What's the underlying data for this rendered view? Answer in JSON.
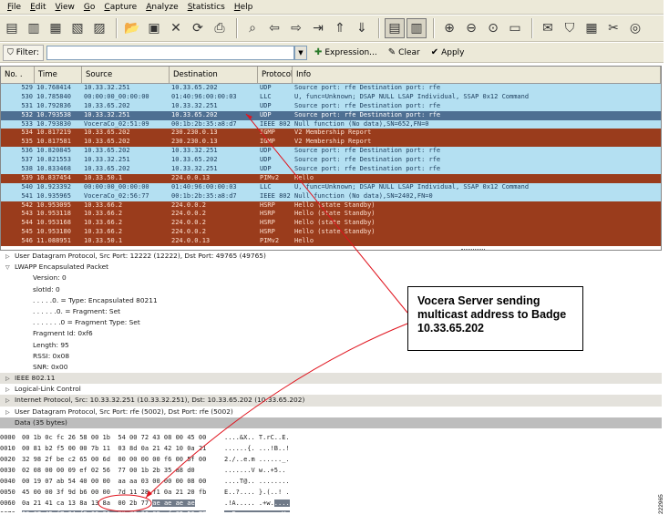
{
  "menubar": {
    "items": [
      "File",
      "Edit",
      "View",
      "Go",
      "Capture",
      "Analyze",
      "Statistics",
      "Help"
    ]
  },
  "toolbar": {
    "buttons": [
      {
        "name": "interface-list-icon",
        "glyph": "▤"
      },
      {
        "name": "capture-options-icon",
        "glyph": "▥"
      },
      {
        "name": "start-capture-icon",
        "glyph": "▦"
      },
      {
        "name": "stop-capture-icon",
        "glyph": "▧"
      },
      {
        "name": "restart-capture-icon",
        "glyph": "▨"
      },
      {
        "name": "open-file-icon",
        "glyph": "📂"
      },
      {
        "name": "save-file-icon",
        "glyph": "▣"
      },
      {
        "name": "close-file-icon",
        "glyph": "✕"
      },
      {
        "name": "reload-icon",
        "glyph": "⟳"
      },
      {
        "name": "print-icon",
        "glyph": "⎙"
      },
      {
        "name": "find-packet-icon",
        "glyph": "⌕"
      },
      {
        "name": "go-back-icon",
        "glyph": "⇦"
      },
      {
        "name": "go-forward-icon",
        "glyph": "⇨"
      },
      {
        "name": "go-to-packet-icon",
        "glyph": "⇥"
      },
      {
        "name": "go-first-icon",
        "glyph": "⇑"
      },
      {
        "name": "go-last-icon",
        "glyph": "⇓"
      },
      {
        "name": "colorize-icon",
        "glyph": "▤"
      },
      {
        "name": "auto-scroll-icon",
        "glyph": "▥"
      },
      {
        "name": "zoom-in-icon",
        "glyph": "⊕"
      },
      {
        "name": "zoom-out-icon",
        "glyph": "⊖"
      },
      {
        "name": "zoom-normal-icon",
        "glyph": "⊙"
      },
      {
        "name": "resize-columns-icon",
        "glyph": "▭"
      },
      {
        "name": "capture-filters-icon",
        "glyph": "✉"
      },
      {
        "name": "display-filters-icon",
        "glyph": "⛉"
      },
      {
        "name": "coloring-rules-icon",
        "glyph": "▦"
      },
      {
        "name": "preferences-icon",
        "glyph": "✂"
      },
      {
        "name": "help-icon",
        "glyph": "◎"
      }
    ]
  },
  "filter": {
    "label": "Filter:",
    "value": "",
    "expression_label": "Expression...",
    "clear_label": "Clear",
    "apply_label": "Apply"
  },
  "packet_list": {
    "columns": [
      "No. .",
      "Time",
      "Source",
      "Destination",
      "Protocol",
      "Info"
    ],
    "rows": [
      {
        "no": "529",
        "time": "10.768414",
        "src": "10.33.32.251",
        "dst": "10.33.65.202",
        "proto": "UDP",
        "info": "Source port: rfe  Destination port: rfe",
        "style": "udp"
      },
      {
        "no": "530",
        "time": "10.785840",
        "src": "00:00:00_00:00:00",
        "dst": "01:40:96:00:00:03",
        "proto": "LLC",
        "info": "U, func=Unknown; DSAP NULL LSAP Individual, SSAP 0x12 Command",
        "style": "udp"
      },
      {
        "no": "531",
        "time": "10.792836",
        "src": "10.33.65.202",
        "dst": "10.33.32.251",
        "proto": "UDP",
        "info": "Source port: rfe  Destination port: rfe",
        "style": "udp"
      },
      {
        "no": "532",
        "time": "10.793538",
        "src": "10.33.32.251",
        "dst": "10.33.65.202",
        "proto": "UDP",
        "info": "Source port: rfe  Destination port: rfe",
        "style": "sel"
      },
      {
        "no": "533",
        "time": "10.793830",
        "src": "VoceraCo_02:51:09",
        "dst": "00:1b:2b:35:a8:d7",
        "proto": "IEEE 802",
        "info": "Null function (No data),SN=652,FN=0",
        "style": "udp"
      },
      {
        "no": "534",
        "time": "10.817219",
        "src": "10.33.65.202",
        "dst": "230.230.0.13",
        "proto": "IGMP",
        "info": "V2 Membership Report",
        "style": "mc"
      },
      {
        "no": "535",
        "time": "10.817581",
        "src": "10.33.65.202",
        "dst": "230.230.0.13",
        "proto": "IGMP",
        "info": "V2 Membership Report",
        "style": "mc"
      },
      {
        "no": "536",
        "time": "10.820845",
        "src": "10.33.65.202",
        "dst": "10.33.32.251",
        "proto": "UDP",
        "info": "Source port: rfe  Destination port: rfe",
        "style": "udp"
      },
      {
        "no": "537",
        "time": "10.821553",
        "src": "10.33.32.251",
        "dst": "10.33.65.202",
        "proto": "UDP",
        "info": "Source port: rfe  Destination port: rfe",
        "style": "udp"
      },
      {
        "no": "538",
        "time": "10.833468",
        "src": "10.33.65.202",
        "dst": "10.33.32.251",
        "proto": "UDP",
        "info": "Source port: rfe  Destination port: rfe",
        "style": "udp"
      },
      {
        "no": "539",
        "time": "10.837454",
        "src": "10.33.50.1",
        "dst": "224.0.0.13",
        "proto": "PIMv2",
        "info": "Hello",
        "style": "mc"
      },
      {
        "no": "540",
        "time": "10.923392",
        "src": "00:00:00_00:00:00",
        "dst": "01:40:96:00:00:03",
        "proto": "LLC",
        "info": "U, func=Unknown; DSAP NULL LSAP Individual, SSAP 0x12 Command",
        "style": "udp"
      },
      {
        "no": "541",
        "time": "10.935965",
        "src": "VoceraCo_02:56:77",
        "dst": "00:1b:2b:35:a8:d7",
        "proto": "IEEE 802",
        "info": "Null function (No data),SN=2402,FN=0",
        "style": "udp"
      },
      {
        "no": "542",
        "time": "10.953095",
        "src": "10.33.66.2",
        "dst": "224.0.0.2",
        "proto": "HSRP",
        "info": "Hello (state Standby)",
        "style": "mc"
      },
      {
        "no": "543",
        "time": "10.953118",
        "src": "10.33.66.2",
        "dst": "224.0.0.2",
        "proto": "HSRP",
        "info": "Hello (state Standby)",
        "style": "mc"
      },
      {
        "no": "544",
        "time": "10.953168",
        "src": "10.33.66.2",
        "dst": "224.0.0.2",
        "proto": "HSRP",
        "info": "Hello (state Standby)",
        "style": "mc"
      },
      {
        "no": "545",
        "time": "10.953180",
        "src": "10.33.66.2",
        "dst": "224.0.0.2",
        "proto": "HSRP",
        "info": "Hello (state Standby)",
        "style": "mc"
      },
      {
        "no": "546",
        "time": "11.088951",
        "src": "10.33.50.1",
        "dst": "224.0.0.13",
        "proto": "PIMv2",
        "info": "Hello",
        "style": "mc"
      }
    ]
  },
  "packet_detail": {
    "lines": [
      {
        "arrow": "▷",
        "indent": 0,
        "text": "User Datagram Protocol, Src Port: 12222 (12222), Dst Port: 49765 (49765)",
        "style": ""
      },
      {
        "arrow": "▽",
        "indent": 0,
        "text": "LWAPP Encapsulated Packet",
        "style": ""
      },
      {
        "arrow": "",
        "indent": 1,
        "text": "Version: 0",
        "style": ""
      },
      {
        "arrow": "",
        "indent": 1,
        "text": "slotId: 0",
        "style": ""
      },
      {
        "arrow": "",
        "indent": 1,
        "text": ". . . . .0. = Type: Encapsulated 80211",
        "style": ""
      },
      {
        "arrow": "",
        "indent": 1,
        "text": ". . . . . .0. = Fragment: Set",
        "style": ""
      },
      {
        "arrow": "",
        "indent": 1,
        "text": ". . . . . . .0 = Fragment Type: Set",
        "style": ""
      },
      {
        "arrow": "",
        "indent": 1,
        "text": "Fragment Id: 0xf6",
        "style": ""
      },
      {
        "arrow": "",
        "indent": 1,
        "text": "Length: 95",
        "style": ""
      },
      {
        "arrow": "",
        "indent": 1,
        "text": "RSSI: 0x08",
        "style": ""
      },
      {
        "arrow": "",
        "indent": 1,
        "text": "SNR: 0x00",
        "style": ""
      },
      {
        "arrow": "▷",
        "indent": 0,
        "text": "IEEE 802.11",
        "style": "grey"
      },
      {
        "arrow": "▷",
        "indent": 0,
        "text": "Logical-Link Control",
        "style": ""
      },
      {
        "arrow": "▷",
        "indent": 0,
        "text": "Internet Protocol, Src: 10.33.32.251 (10.33.32.251), Dst: 10.33.65.202 (10.33.65.202)",
        "style": "grey"
      },
      {
        "arrow": "▷",
        "indent": 0,
        "text": "User Datagram Protocol, Src Port: rfe (5002), Dst Port: rfe (5002)",
        "style": ""
      },
      {
        "arrow": "",
        "indent": 0,
        "text": "Data (35 bytes)",
        "style": "hl"
      }
    ]
  },
  "hex_dump": {
    "rows": [
      {
        "off": "0000",
        "pre": "00 1b 0c fc 26 58 00 1b  54 00 72 43 08 00 45 00",
        "hl": "",
        "post": "",
        "apre": "....&X.. T.rC..E.",
        "ahl": "",
        "apost": ""
      },
      {
        "off": "0010",
        "pre": "00 81 b2 f5 00 00 7b 11  03 8d 0a 21 42 10 0a 21",
        "hl": "",
        "post": "",
        "apre": "......{. ...!B..!",
        "ahl": "",
        "apost": ""
      },
      {
        "off": "0020",
        "pre": "32 98 2f be c2 65 00 6d  00 00 00 00 f6 00 5f 00",
        "hl": "",
        "post": "",
        "apre": "2./..e.m ......_.",
        "ahl": "",
        "apost": ""
      },
      {
        "off": "0030",
        "pre": "02 08 00 00 09 ef 02 56  77 00 1b 2b 35 a8 d0",
        "hl": "",
        "post": "",
        "apre": ".......V w..+5..",
        "ahl": "",
        "apost": ""
      },
      {
        "off": "0040",
        "pre": "00 19 07 ab 54 40 00 00  aa aa 03 00 00 00 08 00",
        "hl": "",
        "post": "",
        "apre": "....T@.. ........",
        "ahl": "",
        "apost": ""
      },
      {
        "off": "0050",
        "pre": "45 00 00 3f 9d b6 00 00  7d 11 28 f1 0a 21 20 fb",
        "hl": "",
        "post": "",
        "apre": "E..?.... }.(..! .",
        "ahl": "",
        "apost": ""
      },
      {
        "off": "0060",
        "pre": "0a 21 41 ca 13 8a 13 8a  00 2b 77 ",
        "hl": "ae ae ae ae",
        "post": "",
        "apre": ".!A..... .+w.",
        "ahl": "....",
        "apost": ""
      },
      {
        "off": "0070",
        "pre": "",
        "hl": "00 07 45 f7 04 f9 00 00  00 72 00 09 ef 02 56 77",
        "post": "",
        "apre": "",
        "ahl": "..E..... .r....Vw",
        "apost": ""
      },
      {
        "off": "0080",
        "pre": "",
        "hl": "00 03 00 01 00 ",
        "post": "",
        "hl2": "e6 e6 00 0d",
        "post2": " 11 50 02 00 00",
        "apre": "",
        "ahl": "....... ..P..",
        "apost": ""
      }
    ]
  },
  "annotation": {
    "callout_text": "Vocera Server sending multicast address to Badge 10.33.65.202",
    "line_color": "#e0141e"
  },
  "figure_id": "222965"
}
